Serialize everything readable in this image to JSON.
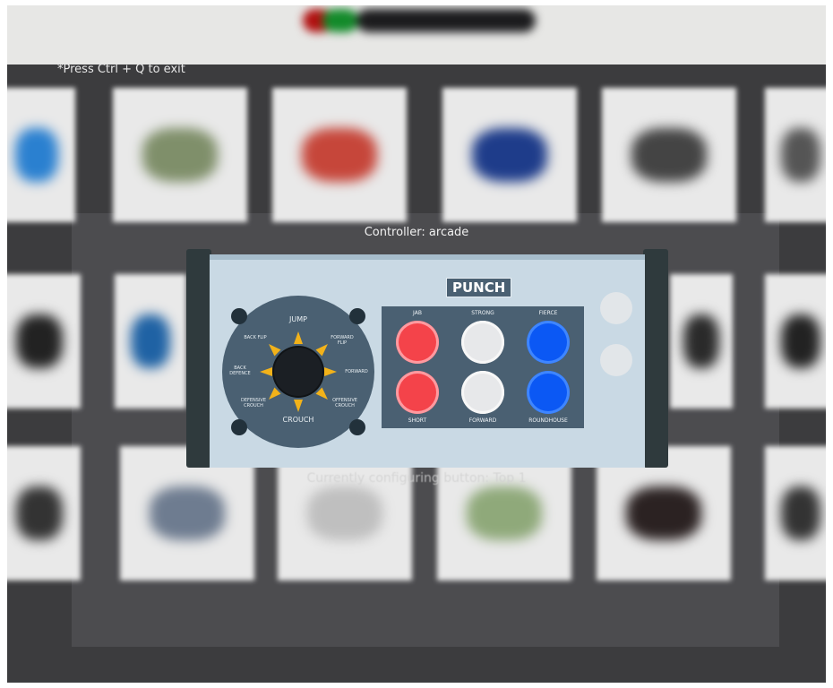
{
  "window": {
    "exit_hint": "*Press Ctrl + Q to exit",
    "controller_label": "Controller: arcade",
    "status_text": "Currently configuring button: Top 1"
  },
  "panel": {
    "title": "PUNCH",
    "stick_directions": {
      "up": "JUMP",
      "down": "CROUCH",
      "up_left": "BACK FLIP",
      "up_right": "FORWARD FLIP",
      "left": "BACK DEFENCE",
      "right": "FORWARD",
      "down_left": "DEFENSIVE CROUCH",
      "down_right": "OFFENSIVE CROUCH"
    },
    "top_labels": [
      "JAB",
      "STRONG",
      "FIERCE"
    ],
    "bottom_labels": [
      "SHORT",
      "FORWARD",
      "ROUNDHOUSE"
    ],
    "colors": {
      "plate": "#4a6072",
      "red_button": "#f4434a",
      "white_button": "#e7e8ea",
      "blue_button": "#0b58f4"
    }
  },
  "icons": {
    "stick": "joystick-icon",
    "arrows": "direction-arrow-icon"
  }
}
